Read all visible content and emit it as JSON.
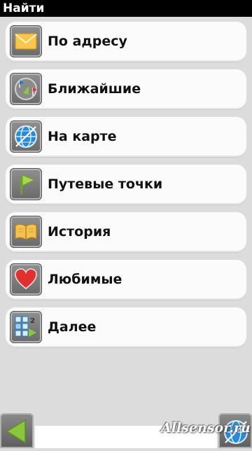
{
  "title": "Найти",
  "menu": {
    "items": [
      {
        "label": "По адресу",
        "icon": "envelope-icon"
      },
      {
        "label": "Ближайшие",
        "icon": "nearby-flags-icon"
      },
      {
        "label": "На карте",
        "icon": "globe-icon"
      },
      {
        "label": "Путевые точки",
        "icon": "flag-icon"
      },
      {
        "label": "История",
        "icon": "book-icon"
      },
      {
        "label": "Любимые",
        "icon": "heart-icon"
      },
      {
        "label": "Далее",
        "icon": "more-icon"
      }
    ]
  },
  "bottom": {
    "back_icon": "back-arrow-icon",
    "map_icon": "globe-icon",
    "watermark": "Allsensor.ru"
  },
  "colors": {
    "titlebar": "#000000",
    "background": "#dcdcdc",
    "item_bg": "#fbfbfb",
    "accent_green": "#8cc63f",
    "accent_blue": "#1e78c8",
    "heart_red": "#e03030",
    "envelope_yellow": "#f7c64a"
  }
}
